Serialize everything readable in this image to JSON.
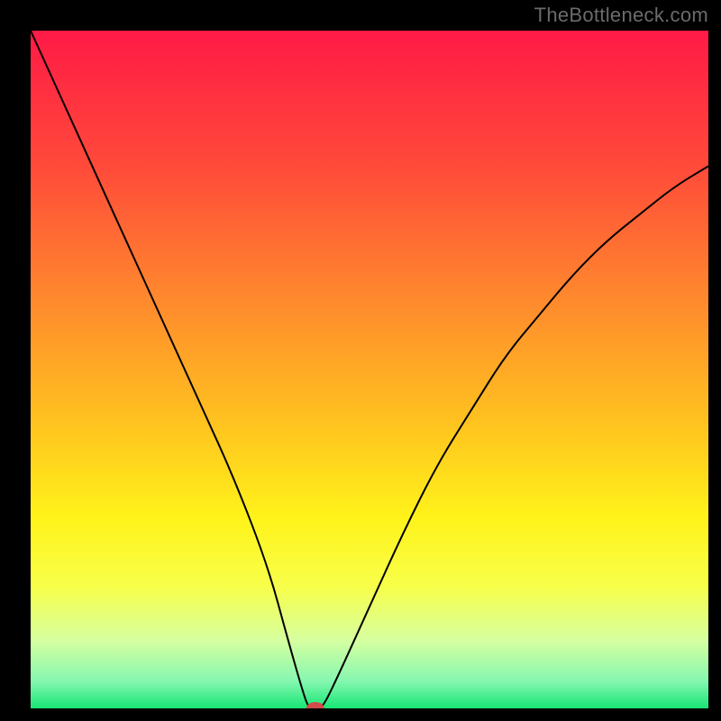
{
  "watermark": "TheBottleneck.com",
  "chart_data": {
    "type": "line",
    "title": "",
    "xlabel": "",
    "ylabel": "",
    "xlim": [
      0,
      100
    ],
    "ylim": [
      0,
      100
    ],
    "grid": false,
    "legend": false,
    "background_gradient": {
      "stops": [
        {
          "offset": 0.0,
          "color": "#ff1a46"
        },
        {
          "offset": 0.2,
          "color": "#ff4a3a"
        },
        {
          "offset": 0.4,
          "color": "#ff8a2d"
        },
        {
          "offset": 0.58,
          "color": "#ffc31f"
        },
        {
          "offset": 0.72,
          "color": "#fff31a"
        },
        {
          "offset": 0.82,
          "color": "#f8ff4a"
        },
        {
          "offset": 0.9,
          "color": "#d6ffa0"
        },
        {
          "offset": 0.96,
          "color": "#85f7b0"
        },
        {
          "offset": 1.0,
          "color": "#17e675"
        }
      ]
    },
    "series": [
      {
        "name": "bottleneck-curve",
        "color": "#000000",
        "width": 2,
        "x": [
          0,
          5,
          10,
          15,
          20,
          25,
          30,
          35,
          38,
          40,
          41,
          42,
          43,
          45,
          50,
          55,
          60,
          65,
          70,
          75,
          80,
          85,
          90,
          95,
          100
        ],
        "y": [
          100,
          89,
          78,
          67,
          56,
          45,
          34,
          21,
          10,
          3,
          0,
          0,
          0,
          4,
          15,
          26,
          36,
          44,
          52,
          58,
          64,
          69,
          73,
          77,
          80
        ]
      }
    ],
    "marker": {
      "name": "optimal-point",
      "x": 42,
      "y": 0,
      "color": "#d24a4a",
      "rx": 10,
      "ry": 7
    }
  }
}
